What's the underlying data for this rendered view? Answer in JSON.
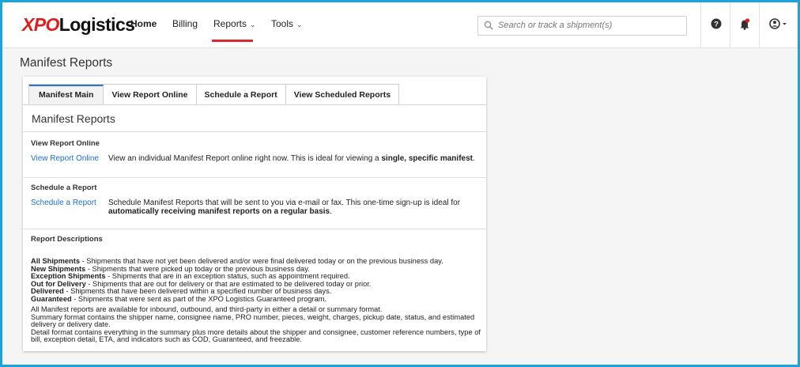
{
  "brand": {
    "logo_xpo": "XPO",
    "logo_rest": "Logistics"
  },
  "nav": {
    "home": "Home",
    "billing": "Billing",
    "reports": "Reports",
    "tools": "Tools"
  },
  "search": {
    "placeholder": "Search or track a shipment(s)"
  },
  "icons": [
    "search-icon",
    "help-icon",
    "notification-bell-icon",
    "user-account-icon",
    "chevron-down-icon"
  ],
  "colors": {
    "brand_red": "#e21c1c",
    "link_blue": "#1a6fd1",
    "active_tab": "#2f6fd6",
    "frame": "#1aa3dc"
  },
  "page": {
    "title": "Manifest Reports"
  },
  "tabs": [
    {
      "label": "Manifest Main",
      "active": true
    },
    {
      "label": "View Report Online",
      "active": false
    },
    {
      "label": "Schedule a Report",
      "active": false
    },
    {
      "label": "View Scheduled Reports",
      "active": false
    }
  ],
  "main": {
    "section_title": "Manifest Reports",
    "view_online": {
      "heading": "View Report Online",
      "link": "View Report Online",
      "desc_text": "View an individual Manifest Report online right now. This is ideal for viewing a ",
      "desc_bold": "single, specific manifest",
      "desc_end": "."
    },
    "schedule": {
      "heading": "Schedule a Report",
      "link": "Schedule a Report",
      "desc_text": "Schedule Manifest Reports that will be sent to you via e-mail or fax. This one-time sign-up is ideal for ",
      "desc_bold": "automatically receiving manifest reports on a regular basis",
      "desc_end": "."
    },
    "descriptions": {
      "heading": "Report Descriptions",
      "items": [
        {
          "term": "All Shipments",
          "text": " - Shipments that have not yet been delivered and/or were final delivered today or on the previous business day."
        },
        {
          "term": "New Shipments",
          "text": " - Shipments that were picked up today or the previous business day."
        },
        {
          "term": "Exception Shipments",
          "text": " - Shipments that are in an exception status, such as appointment required."
        },
        {
          "term": "Out for Delivery",
          "text": " - Shipments that are out for delivery or that are estimated to be delivered today or prior."
        },
        {
          "term": "Delivered",
          "text": " - Shipments that have been delivered within a specified number of business days."
        },
        {
          "term": "Guaranteed",
          "text": " - Shipments that were sent as part of the XPO Logistics Guaranteed program."
        }
      ],
      "notes": [
        "All Manifest reports are available for inbound, outbound, and third-party in either a detail or summary format.",
        "Summary format contains the shipper name, consignee name, PRO number, pieces, weight, charges, pickup date, status, and estimated delivery or delivery date.",
        "Detail format contains everything in the summary plus more details about the shipper and consignee, customer reference numbers, type of bill, exception detail, ETA, and indicators such as COD, Guaranteed, and freezable."
      ]
    }
  }
}
